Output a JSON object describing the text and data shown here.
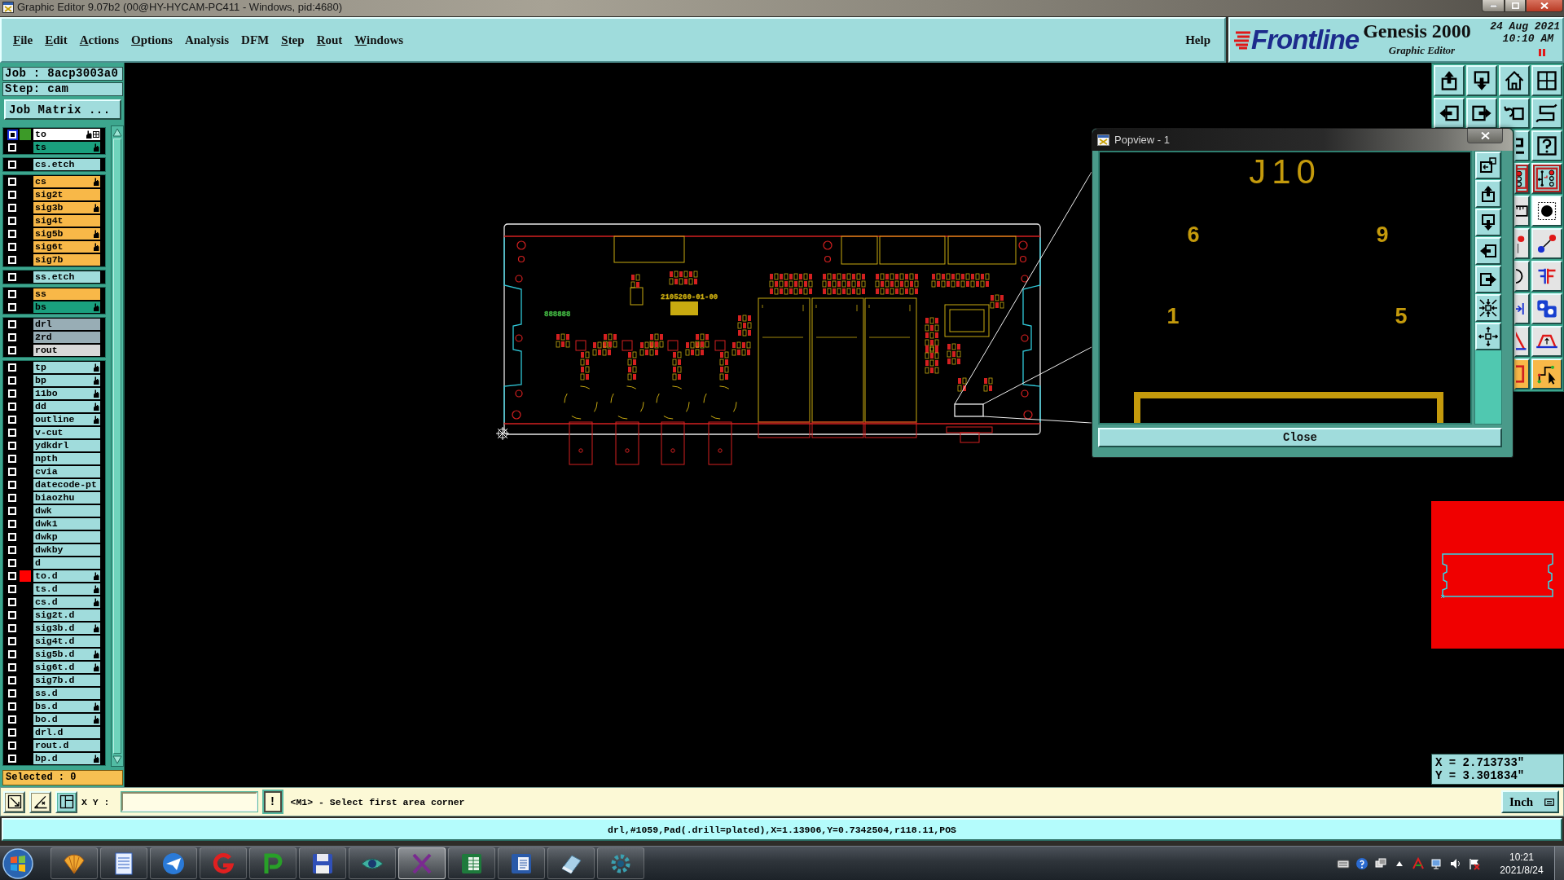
{
  "window": {
    "title": "Graphic Editor 9.07b2 (00@HY-HYCAM-PC411 - Windows, pid:4680)"
  },
  "menu": {
    "items": [
      {
        "label": "File",
        "mnemonic": true
      },
      {
        "label": "Edit",
        "mnemonic": true
      },
      {
        "label": "Actions",
        "mnemonic": true
      },
      {
        "label": "Options",
        "mnemonic": true
      },
      {
        "label": "Analysis",
        "mnemonic": false
      },
      {
        "label": "DFM",
        "mnemonic": false
      },
      {
        "label": "Step",
        "mnemonic": true
      },
      {
        "label": "Rout",
        "mnemonic": true
      },
      {
        "label": "Windows",
        "mnemonic": true
      }
    ],
    "help": "Help"
  },
  "brand": {
    "logo": "Frontline",
    "product": "Genesis 2000",
    "subtitle": "Graphic Editor",
    "date": "24 Aug 2021",
    "time": "10:10 AM"
  },
  "job_panel": {
    "job": "Job : 8acp3003a0",
    "step": "Step: cam",
    "matrix_button": "Job Matrix ...",
    "layer_groups": [
      {
        "layers": [
          {
            "name": "to",
            "color": "#ffffff",
            "swatch": {
              "color": "#3c9a28"
            },
            "affected": true,
            "hand": true,
            "grid": true
          },
          {
            "name": "ts",
            "color": "#1aa07e",
            "affected": false,
            "hand": true,
            "grid": false
          }
        ]
      },
      {
        "layers": [
          {
            "name": "cs.etch",
            "color": "#a0dcdc",
            "affected": false,
            "hand": false,
            "grid": false
          }
        ]
      },
      {
        "layers": [
          {
            "name": "cs",
            "color": "#f8b848",
            "affected": false,
            "hand": true,
            "grid": false
          },
          {
            "name": "sig2t",
            "color": "#f8b848",
            "affected": false,
            "hand": false,
            "grid": false
          },
          {
            "name": "sig3b",
            "color": "#f8b848",
            "affected": false,
            "hand": true,
            "grid": false
          },
          {
            "name": "sig4t",
            "color": "#f8b848",
            "affected": false,
            "hand": false,
            "grid": false
          },
          {
            "name": "sig5b",
            "color": "#f8b848",
            "affected": false,
            "hand": true,
            "grid": false
          },
          {
            "name": "sig6t",
            "color": "#f8b848",
            "affected": false,
            "hand": true,
            "grid": false
          },
          {
            "name": "sig7b",
            "color": "#f8b848",
            "affected": false,
            "hand": false,
            "grid": false
          }
        ]
      },
      {
        "layers": [
          {
            "name": "ss.etch",
            "color": "#a0dcdc",
            "affected": false,
            "hand": false,
            "grid": false
          }
        ]
      },
      {
        "layers": [
          {
            "name": "ss",
            "color": "#f8b848",
            "affected": false,
            "hand": false,
            "grid": false
          },
          {
            "name": "bs",
            "color": "#1aa07e",
            "affected": false,
            "hand": true,
            "grid": false
          }
        ]
      },
      {
        "layers": [
          {
            "name": "drl",
            "color": "#98adb5",
            "affected": false,
            "hand": false,
            "grid": false
          },
          {
            "name": "2rd",
            "color": "#98adb5",
            "affected": false,
            "hand": false,
            "grid": false
          },
          {
            "name": "rout",
            "color": "#d8d8d8",
            "affected": false,
            "hand": false,
            "grid": false
          }
        ]
      },
      {
        "layers": [
          {
            "name": "tp",
            "color": "#a0dcdc",
            "affected": false,
            "hand": true,
            "grid": false
          },
          {
            "name": "bp",
            "color": "#a0dcdc",
            "affected": false,
            "hand": true,
            "grid": false
          },
          {
            "name": "11bo",
            "color": "#a0dcdc",
            "affected": false,
            "hand": true,
            "grid": false
          },
          {
            "name": "dd",
            "color": "#a0dcdc",
            "affected": false,
            "hand": true,
            "grid": false
          },
          {
            "name": "outline",
            "color": "#a0dcdc",
            "affected": false,
            "hand": true,
            "grid": false
          },
          {
            "name": "v-cut",
            "color": "#a0dcdc",
            "affected": false,
            "hand": false,
            "grid": false
          },
          {
            "name": "ydkdrl",
            "color": "#a0dcdc",
            "affected": false,
            "hand": false,
            "grid": false
          },
          {
            "name": "npth",
            "color": "#a0dcdc",
            "affected": false,
            "hand": false,
            "grid": false
          },
          {
            "name": "cvia",
            "color": "#a0dcdc",
            "affected": false,
            "hand": false,
            "grid": false
          },
          {
            "name": "datecode-pt",
            "color": "#a0dcdc",
            "affected": false,
            "hand": false,
            "grid": false
          },
          {
            "name": "biaozhu",
            "color": "#a0dcdc",
            "affected": false,
            "hand": false,
            "grid": false
          },
          {
            "name": "dwk",
            "color": "#a0dcdc",
            "affected": false,
            "hand": false,
            "grid": false
          },
          {
            "name": "dwk1",
            "color": "#a0dcdc",
            "affected": false,
            "hand": false,
            "grid": false
          },
          {
            "name": "dwkp",
            "color": "#a0dcdc",
            "affected": false,
            "hand": false,
            "grid": false
          },
          {
            "name": "dwkby",
            "color": "#a0dcdc",
            "affected": false,
            "hand": false,
            "grid": false
          },
          {
            "name": "d",
            "color": "#a0dcdc",
            "affected": false,
            "hand": false,
            "grid": false
          },
          {
            "name": "to.d",
            "color": "#a0dcdc",
            "swatch": {
              "color": "#ff0000"
            },
            "affected": false,
            "hand": true,
            "grid": false
          },
          {
            "name": "ts.d",
            "color": "#a0dcdc",
            "affected": false,
            "hand": true,
            "grid": false
          },
          {
            "name": "cs.d",
            "color": "#a0dcdc",
            "affected": false,
            "hand": true,
            "grid": false
          },
          {
            "name": "sig2t.d",
            "color": "#a0dcdc",
            "affected": false,
            "hand": false,
            "grid": false
          },
          {
            "name": "sig3b.d",
            "color": "#a0dcdc",
            "affected": false,
            "hand": true,
            "grid": false
          },
          {
            "name": "sig4t.d",
            "color": "#a0dcdc",
            "affected": false,
            "hand": false,
            "grid": false
          },
          {
            "name": "sig5b.d",
            "color": "#a0dcdc",
            "affected": false,
            "hand": true,
            "grid": false
          },
          {
            "name": "sig6t.d",
            "color": "#a0dcdc",
            "affected": false,
            "hand": true,
            "grid": false
          },
          {
            "name": "sig7b.d",
            "color": "#a0dcdc",
            "affected": false,
            "hand": false,
            "grid": false
          },
          {
            "name": "ss.d",
            "color": "#a0dcdc",
            "affected": false,
            "hand": false,
            "grid": false
          },
          {
            "name": "bs.d",
            "color": "#a0dcdc",
            "affected": false,
            "hand": true,
            "grid": false
          },
          {
            "name": "bo.d",
            "color": "#a0dcdc",
            "affected": false,
            "hand": true,
            "grid": false
          },
          {
            "name": "drl.d",
            "color": "#a0dcdc",
            "affected": false,
            "hand": false,
            "grid": false
          },
          {
            "name": "rout.d",
            "color": "#a0dcdc",
            "affected": false,
            "hand": false,
            "grid": false
          },
          {
            "name": "bp.d",
            "color": "#a0dcdc",
            "affected": false,
            "hand": true,
            "grid": false
          }
        ]
      }
    ],
    "selected": "Selected : 0"
  },
  "canvas": {
    "labels": [
      {
        "text": "888888",
        "color": "#40b040"
      },
      {
        "text": "2105260-01-00",
        "color": "#c8aa10"
      }
    ]
  },
  "popview": {
    "title": "Popview - 1",
    "reference": "J10",
    "pins": [
      "6",
      "9",
      "1",
      "5"
    ],
    "close_button": "Close"
  },
  "coordinates": {
    "x": "X = 2.713733\"",
    "y": "Y = 3.301834\""
  },
  "command_bar": {
    "label": "X Y :",
    "alert_button": "!",
    "message": "<M1> - Select first area corner",
    "units_button": "Inch"
  },
  "status_line": "drl,#1059,Pad(.drill=plated),X=1.13906,Y=0.7342504,r118.11,POS",
  "taskbar": {
    "apps": [
      {
        "kind": "shell",
        "selected": false
      },
      {
        "kind": "notepad",
        "selected": false
      },
      {
        "kind": "plane",
        "selected": false
      },
      {
        "kind": "swirl",
        "selected": false
      },
      {
        "kind": "leaf",
        "selected": false
      },
      {
        "kind": "floppy",
        "selected": false
      },
      {
        "kind": "eye",
        "selected": false
      },
      {
        "kind": "cross",
        "selected": true
      },
      {
        "kind": "sheet",
        "selected": false
      },
      {
        "kind": "doc",
        "selected": false
      },
      {
        "kind": "eraser",
        "selected": false
      },
      {
        "kind": "gear",
        "selected": false
      }
    ],
    "clock": {
      "time": "10:21",
      "date": "2021/8/24"
    }
  }
}
